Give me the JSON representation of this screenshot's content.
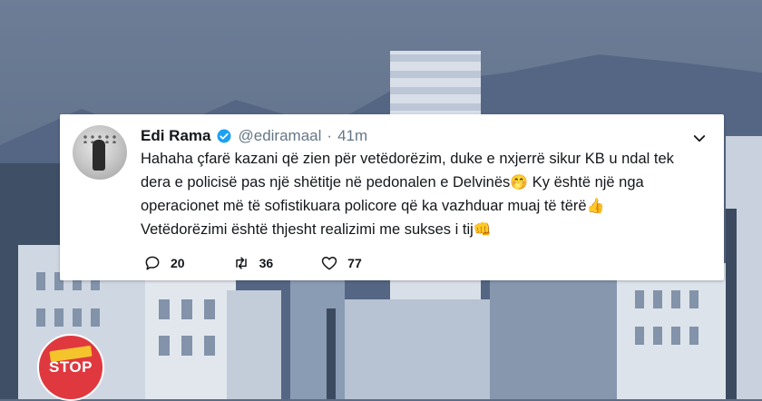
{
  "tweet": {
    "name": "Edi Rama",
    "handle": "@ediramaal",
    "separator": "·",
    "time": "41m",
    "text_line1": "Hahaha çfarë kazani që zien për vetëdorëzim, duke e nxjerrë sikur KB u ndal tek",
    "text_line2": "dera e policisë pas një shëtitje në pedonalen e Delvinës",
    "emoji_line2": "🤭",
    "text_line2b": " Ky është një nga",
    "text_line3": "operacionet më të sofistikuara policore që ka vazhduar muaj të tërë",
    "emoji_line3": "👍",
    "text_line4": "Vetëdorëzimi është thjesht realizimi me sukses i tij",
    "emoji_line4": "👊",
    "reply_count": "20",
    "retweet_count": "36",
    "like_count": "77"
  },
  "logo": {
    "text": "STOP"
  },
  "colors": {
    "accent": "#1da1f2",
    "text": "#14171a",
    "muted": "#657786",
    "logo_red": "#e0383f"
  },
  "icons": [
    "verified-badge-icon",
    "chevron-down-icon",
    "reply-icon",
    "retweet-icon",
    "like-icon"
  ]
}
